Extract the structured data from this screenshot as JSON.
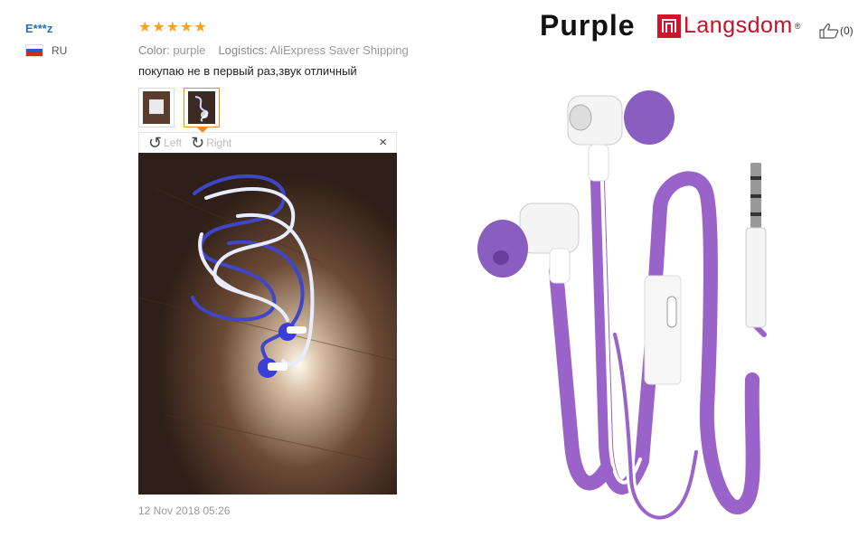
{
  "user": {
    "name": "E***z",
    "country": "RU"
  },
  "review": {
    "stars": 5,
    "color_label": "Color:",
    "color_value": "purple",
    "logistics_label": "Logistics:",
    "logistics_value": "AliExpress Saver Shipping",
    "comment": "покупаю не в первый раз,звук отличный",
    "date": "12 Nov 2018 05:26"
  },
  "viewer": {
    "rotate_left": "Left",
    "rotate_right": "Right",
    "close": "×"
  },
  "thumbnails": [
    "photo-1",
    "photo-2"
  ],
  "product": {
    "heading": "Purple",
    "brand": "Langsdom",
    "brand_reg": "®"
  },
  "likes": {
    "count": "(0)"
  },
  "colors": {
    "accent": "#f58a1f",
    "star": "#f7a21b",
    "link": "#2a6fb8",
    "brand": "#d0142c",
    "purple": "#9a63c9"
  }
}
